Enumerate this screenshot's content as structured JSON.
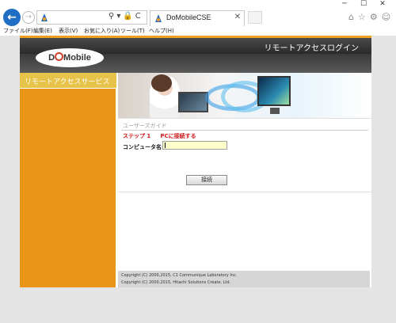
{
  "window": {
    "minimize_glyph": "─",
    "maximize_glyph": "☐",
    "close_glyph": "✕"
  },
  "nav": {
    "back_glyph": "←",
    "forward_glyph": "→",
    "address_tools": "⚲▾🔒C",
    "tab_title": "DoMobileCSE",
    "tab_close_glyph": "✕",
    "right_icons": "⌂☆⚙☺"
  },
  "menu": {
    "file": "ファイル(F)",
    "edit": "編集(E)",
    "view": "表示(V)",
    "favorites": "お気に入り(A)",
    "tools": "ツール(T)",
    "help": "ヘルプ(H)"
  },
  "header": {
    "title": "リモートアクセスログイン",
    "logo_d": "D",
    "logo_rest": "Mobile"
  },
  "sidebar": {
    "title": "リモートアクセスサービス"
  },
  "main": {
    "guide": "ユーザーズガイド",
    "step_number": "ステップ 1",
    "step_text": "PCに接続する",
    "pc_label": "コンピュータ名:",
    "pc_value": "",
    "connect_label": "接続"
  },
  "footer": {
    "copyright1": "Copyright (C) 2000,2015, C1 Communique Laboratory Inc.",
    "copyright2": "Copyright (C) 2000,2015, Hitachi Solutions Create, Ltd."
  },
  "colors": {
    "sidebar_orange": "#e89518",
    "step_red": "#cc1a1a",
    "input_yellow": "#ffffcc",
    "header_dark": "#333333",
    "back_blue": "#1e6fc4"
  },
  "icons": {
    "back": "back-arrow-icon",
    "forward": "forward-arrow-icon",
    "favicon": "domobile-favicon-icon",
    "home": "home-icon",
    "favorites": "star-icon",
    "settings": "gear-icon",
    "smiley": "smiley-icon"
  }
}
